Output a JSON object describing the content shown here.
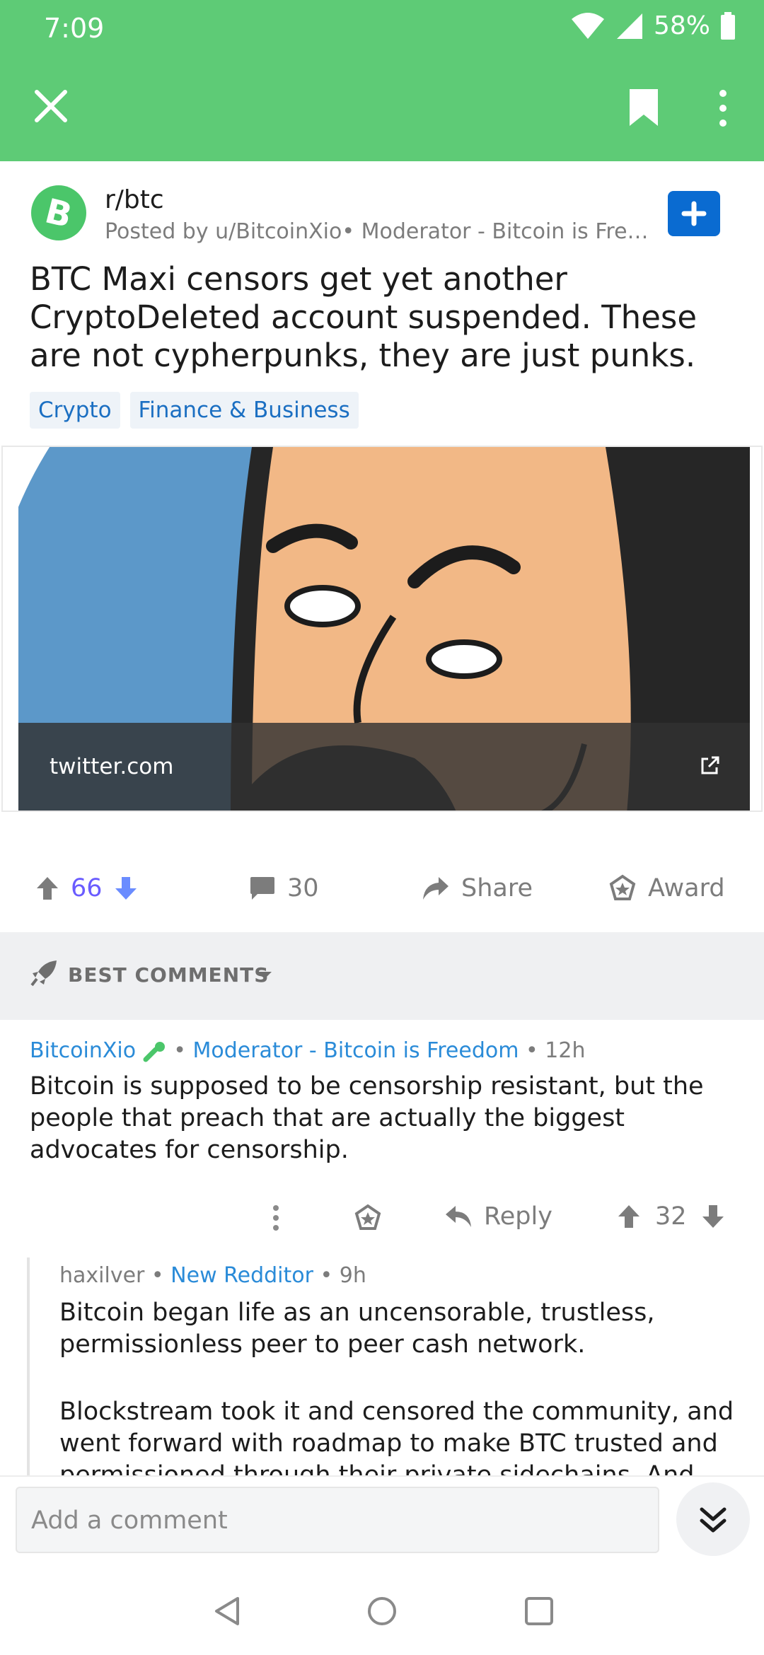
{
  "status_bar": {
    "time": "7:09",
    "battery": "58%"
  },
  "app_bar": {
    "close_icon": "close-icon",
    "bookmark_icon": "bookmark-icon",
    "overflow_icon": "more-vertical-icon"
  },
  "post": {
    "subreddit": "r/btc",
    "meta": "Posted by u/BitcoinXio• Moderator - Bitcoin is Freed...",
    "title": "BTC Maxi censors get yet another CryptoDeleted account suspended. These are not cypherpunks, they are just punks.",
    "flairs": [
      "Crypto",
      "Finance & Business"
    ],
    "link_domain": "twitter.com",
    "score": "66",
    "comments_count": "30",
    "share_label": "Share",
    "award_label": "Award"
  },
  "sort": {
    "label": "BEST COMMENTS"
  },
  "comments": [
    {
      "author": "BitcoinXio",
      "flair": "Moderator - Bitcoin is Freedom",
      "age": "12h",
      "body": "Bitcoin is supposed to be censorship resistant, but the people that preach that are actually the biggest advocates for censorship.",
      "reply_label": "Reply",
      "score": "32"
    },
    {
      "author": "haxilver",
      "flair": "New Redditor",
      "age": "9h",
      "body_p1": "Bitcoin began life as an uncensorable, trustless, permissionless peer to peer cash network.",
      "body_p2": "Blockstream took it and censored the community, and went forward with roadmap to make BTC trusted and permissioned through their private sidechains. And"
    }
  ],
  "composer": {
    "placeholder": "Add a comment"
  },
  "colors": {
    "appbar": "#5ecb76",
    "accent_blue": "#0a6bd1",
    "link_blue": "#2a8bd8",
    "upvote": "#6a5cff"
  }
}
